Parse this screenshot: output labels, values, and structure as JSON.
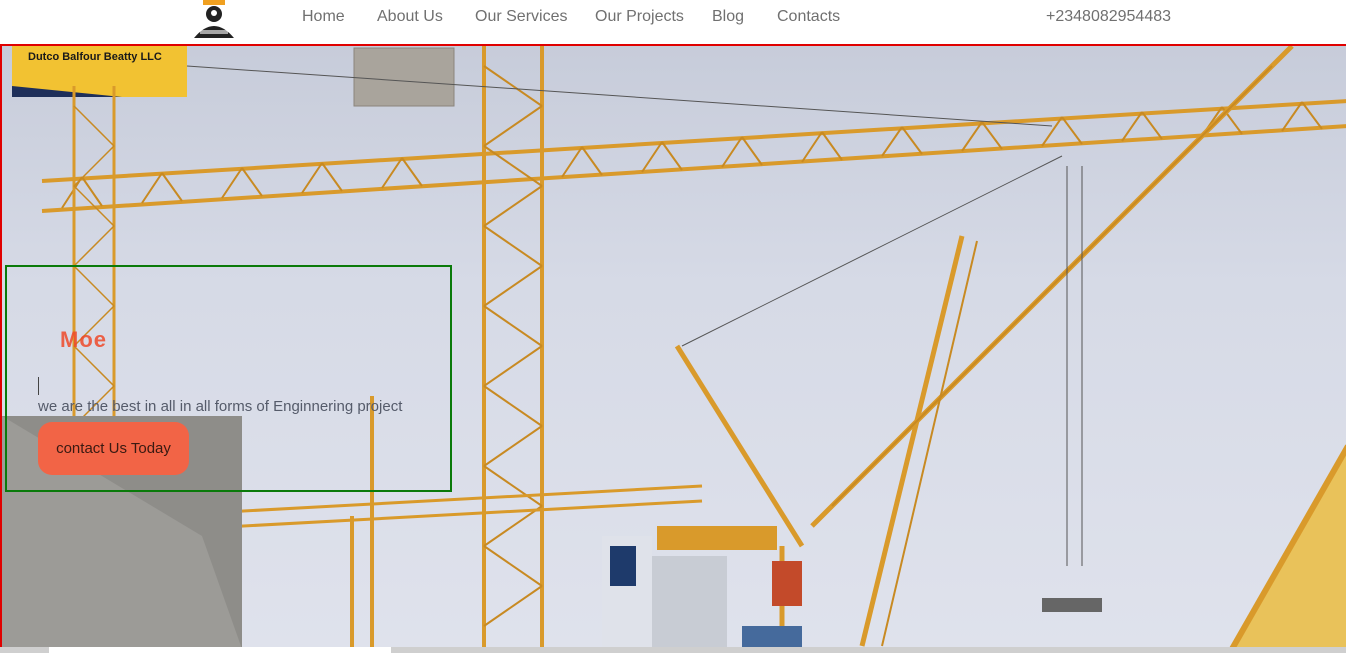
{
  "header": {
    "nav": [
      "Home",
      "About Us",
      "Our Services",
      "Our Projects",
      "Blog",
      "Contacts"
    ],
    "phone": "+2348082954483"
  },
  "hero": {
    "heading": "Moe",
    "tagline": "we are the best in all in all forms of Enginnering project",
    "cta_label": "contact Us Today",
    "billboard_text": "Dutco Balfour Beatty LLC"
  },
  "colors": {
    "accent": "#f26446",
    "crane": "#d99a2b",
    "sky": "#d6dae6"
  }
}
